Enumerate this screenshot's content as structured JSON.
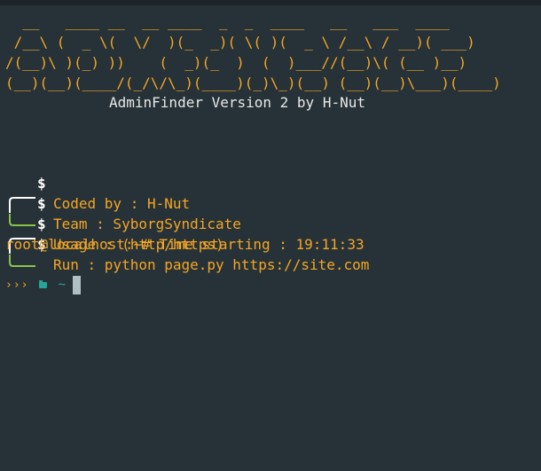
{
  "banner": {
    "ascii_art": "  __   ____ __  __ ____  _  _  ____   __   ___  ____\n /__\\ (  _ \\(  \\/  )(_  _)( \\( )(  _ \\ /__\\ / __)( ___)\n/(__)\\ )(_) ))    (  _)(_  )  (  )___//(__)\\( (__ )__)\n(__)(__)(____/(_/\\/\\_)(____)(_)\\_)(__) (__)(__)\\___)(____)",
    "version_text": "AdminFinder Version 2 by H-Nut"
  },
  "info": [
    {
      "text": "Coded by : H-Nut"
    },
    {
      "text": "Team : SyborgSyndicate"
    },
    {
      "text": "Usage : (http/https)"
    },
    {
      "text": "Run : python page.py https://site.com"
    }
  ],
  "info_symbol": "$",
  "status": {
    "text": "root@localhost:~# Time starting : 19:11:33"
  },
  "prompt": {
    "arrows": "›››",
    "folder_icon": "folder-icon",
    "path": "~"
  },
  "colors": {
    "background": "#263238",
    "accent_orange": "#f5a623",
    "accent_green": "#8bc34a",
    "accent_teal": "#26a69a",
    "text_light": "#e8e8e8",
    "cursor": "#b0bec5"
  }
}
